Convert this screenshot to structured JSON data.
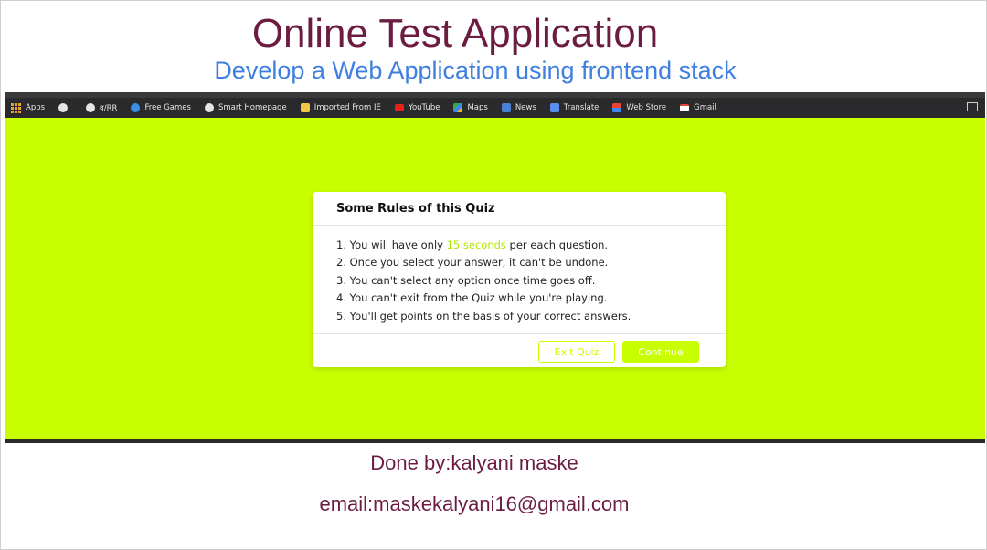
{
  "header": {
    "title": "Online Test Application",
    "subtitle": "Develop a Web Application using frontend stack"
  },
  "bookmarks": [
    {
      "label": "Apps",
      "icon": "apps-grid-icon"
    },
    {
      "label": "",
      "icon": "globe-icon"
    },
    {
      "label": "व/RR",
      "icon": "globe-icon"
    },
    {
      "label": "Free Games",
      "icon": "game-icon"
    },
    {
      "label": "Smart Homepage",
      "icon": "globe-icon"
    },
    {
      "label": "Imported From IE",
      "icon": "folder-icon"
    },
    {
      "label": "YouTube",
      "icon": "youtube-icon"
    },
    {
      "label": "Maps",
      "icon": "maps-icon"
    },
    {
      "label": "News",
      "icon": "news-icon"
    },
    {
      "label": "Translate",
      "icon": "translate-icon"
    },
    {
      "label": "Web Store",
      "icon": "store-icon"
    },
    {
      "label": "Gmail",
      "icon": "gmail-icon"
    }
  ],
  "modal": {
    "title": "Some Rules of this Quiz",
    "rule1_pre": "1. You will have only ",
    "rule1_highlight": "15 seconds",
    "rule1_post": " per each question.",
    "rules": [
      "2. Once you select your answer, it can't be undone.",
      "3. You can't select any option once time goes off.",
      "4. You can't exit from the Quiz while you're playing.",
      "5. You'll get points on the basis of your correct answers."
    ],
    "exit_label": "Exit Quiz",
    "continue_label": "Continue"
  },
  "footer": {
    "done_by": "Done by:kalyani maske",
    "email": "email:maskekalyani16@gmail.com"
  },
  "colors": {
    "accent": "#c8ff00",
    "title": "#6b1c40",
    "subtitle": "#3f7fe0"
  }
}
